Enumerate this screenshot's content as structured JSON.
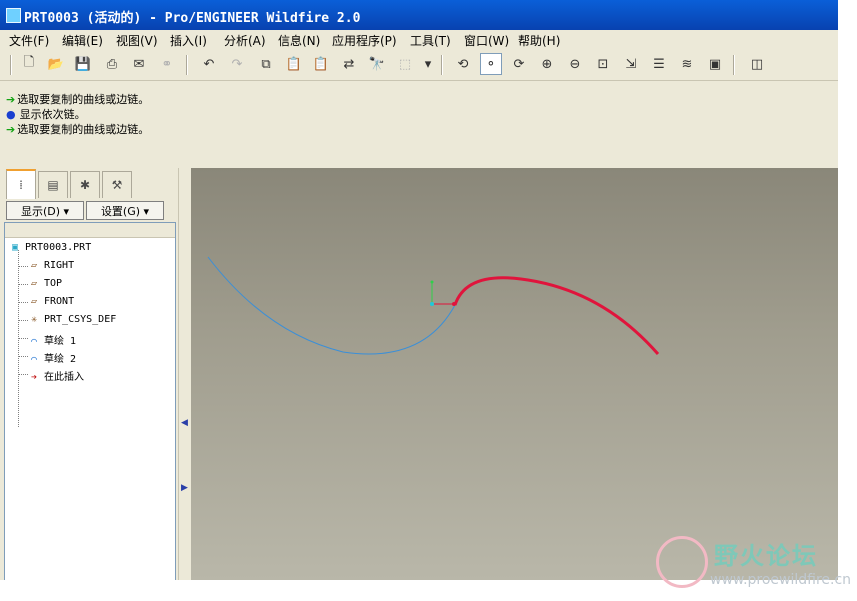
{
  "window": {
    "title": "PRT0003 (活动的) - Pro/ENGINEER Wildfire 2.0"
  },
  "menu": [
    "文件(F)",
    "编辑(E)",
    "视图(V)",
    "插入(I)",
    "分析(A)",
    "信息(N)",
    "应用程序(P)",
    "工具(T)",
    "窗口(W)",
    "帮助(H)"
  ],
  "toolbar": {
    "buttons": [
      {
        "name": "new-icon",
        "glyph": "🗋"
      },
      {
        "name": "open-icon",
        "glyph": "📂"
      },
      {
        "name": "save-icon",
        "glyph": "💾"
      },
      {
        "name": "print-icon",
        "glyph": "⎙"
      },
      {
        "name": "send-email-icon",
        "glyph": "✉"
      },
      {
        "name": "send-link-icon",
        "glyph": "⚭"
      },
      {
        "name": "undo-icon",
        "glyph": "↶"
      },
      {
        "name": "redo-icon",
        "glyph": "↷"
      },
      {
        "name": "copy-icon",
        "glyph": "⧉"
      },
      {
        "name": "paste-icon",
        "glyph": "📋"
      },
      {
        "name": "paste-special-icon",
        "glyph": "📋"
      },
      {
        "name": "regenerate-icon",
        "glyph": "⇄"
      },
      {
        "name": "find-icon",
        "glyph": "🔭"
      },
      {
        "name": "selection-filter-icon",
        "glyph": "⬚"
      },
      {
        "name": "filter-dropdown-icon",
        "glyph": "▾"
      },
      {
        "name": "redraw-icon",
        "glyph": "⟲"
      },
      {
        "name": "spin-center-icon",
        "glyph": "⚬"
      },
      {
        "name": "orient-mode-icon",
        "glyph": "⟳"
      },
      {
        "name": "zoom-in-icon",
        "glyph": "⊕"
      },
      {
        "name": "zoom-out-icon",
        "glyph": "⊖"
      },
      {
        "name": "refit-icon",
        "glyph": "⊡"
      },
      {
        "name": "reorient-icon",
        "glyph": "⇲"
      },
      {
        "name": "saved-views-icon",
        "glyph": "☰"
      },
      {
        "name": "layers-icon",
        "glyph": "≋"
      },
      {
        "name": "view-manager-icon",
        "glyph": "▣"
      },
      {
        "name": "display-style-icon",
        "glyph": "◫"
      }
    ]
  },
  "messages": [
    {
      "type": "prompt",
      "text": "选取要复制的曲线或边链。"
    },
    {
      "type": "info",
      "text": "显示依次链。"
    },
    {
      "type": "prompt",
      "text": "选取要复制的曲线或边链。"
    }
  ],
  "panel": {
    "show_label": "显示(D) ▾",
    "settings_label": "设置(G) ▾",
    "tree": {
      "root": "PRT0003.PRT",
      "items": [
        {
          "label": "RIGHT",
          "icon": "datum-plane-icon"
        },
        {
          "label": "TOP",
          "icon": "datum-plane-icon"
        },
        {
          "label": "FRONT",
          "icon": "datum-plane-icon"
        },
        {
          "label": "PRT_CSYS_DEF",
          "icon": "csys-icon"
        },
        {
          "label": "草绘 1",
          "icon": "sketch-icon"
        },
        {
          "label": "草绘 2",
          "icon": "sketch-icon"
        },
        {
          "label": "在此插入",
          "icon": "insert-here-icon"
        }
      ]
    }
  },
  "colors": {
    "viewport_top": "#8a8779",
    "viewport_bottom": "#b9b7a9",
    "curve_selected": "#e0143c",
    "curve_normal": "#3a8fd8"
  },
  "watermark": {
    "title": "野火论坛",
    "url": "www.proewildfire.cn"
  }
}
